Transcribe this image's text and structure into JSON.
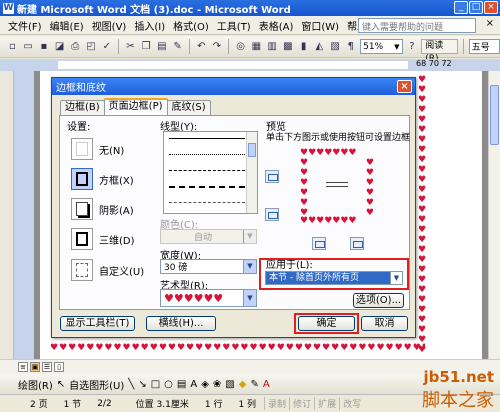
{
  "window": {
    "title": "新建 Microsoft Word 文档 (3).doc - Microsoft Word",
    "icon": "word-icon"
  },
  "menu": {
    "items": [
      "文件(F)",
      "编辑(E)",
      "视图(V)",
      "插入(I)",
      "格式(O)",
      "工具(T)",
      "表格(A)",
      "窗口(W)",
      "帮助(H)"
    ],
    "help_placeholder": "键入需要帮助的问题"
  },
  "toolbar": {
    "zoom": "51%",
    "read_label": "阅读(R)",
    "font_size": "五号"
  },
  "ruler": {
    "numbers": "68 70 72"
  },
  "dialog": {
    "title": "边框和底纹",
    "tabs": [
      "边框(B)",
      "页面边框(P)",
      "底纹(S)"
    ],
    "active_tab": 1,
    "setting_label": "设置:",
    "settings": [
      "无(N)",
      "方框(X)",
      "阴影(A)",
      "三维(D)",
      "自定义(U)"
    ],
    "selected_setting": 1,
    "style_label": "线型(Y):",
    "color_label": "颜色(C):",
    "color_value": "自动",
    "width_label": "宽度(W):",
    "width_value": "30 磅",
    "art_label": "艺术型(R):",
    "art_value": "♥♥♥♥♥♥",
    "preview_label": "预览",
    "preview_hint": "单击下方图示或使用按钮可设置边框",
    "apply_label": "应用于(L):",
    "apply_value": "本节 - 除首页外所有页",
    "options_button": "选项(O)...",
    "show_toolbar_button": "显示工具栏(T)",
    "hline_button": "横线(H)...",
    "ok_button": "确定",
    "cancel_button": "取消"
  },
  "drawbar": {
    "draw_label": "绘图(R)",
    "autoshapes_label": "自选图形(U)"
  },
  "status": {
    "page": "2 页",
    "section": "1 节",
    "page_of": "2/2",
    "position": "位置 3.1厘米",
    "line": "1 行",
    "column": "1 列",
    "modes": [
      "录制",
      "修订",
      "扩展",
      "改写"
    ]
  },
  "watermark": {
    "top": "jb51.net",
    "bottom": "脚本之家"
  },
  "colors": {
    "title_blue": "#1e5fd9",
    "heart_red": "#d4143a",
    "highlight_red": "#e02020",
    "selection_blue": "#316ac5"
  }
}
